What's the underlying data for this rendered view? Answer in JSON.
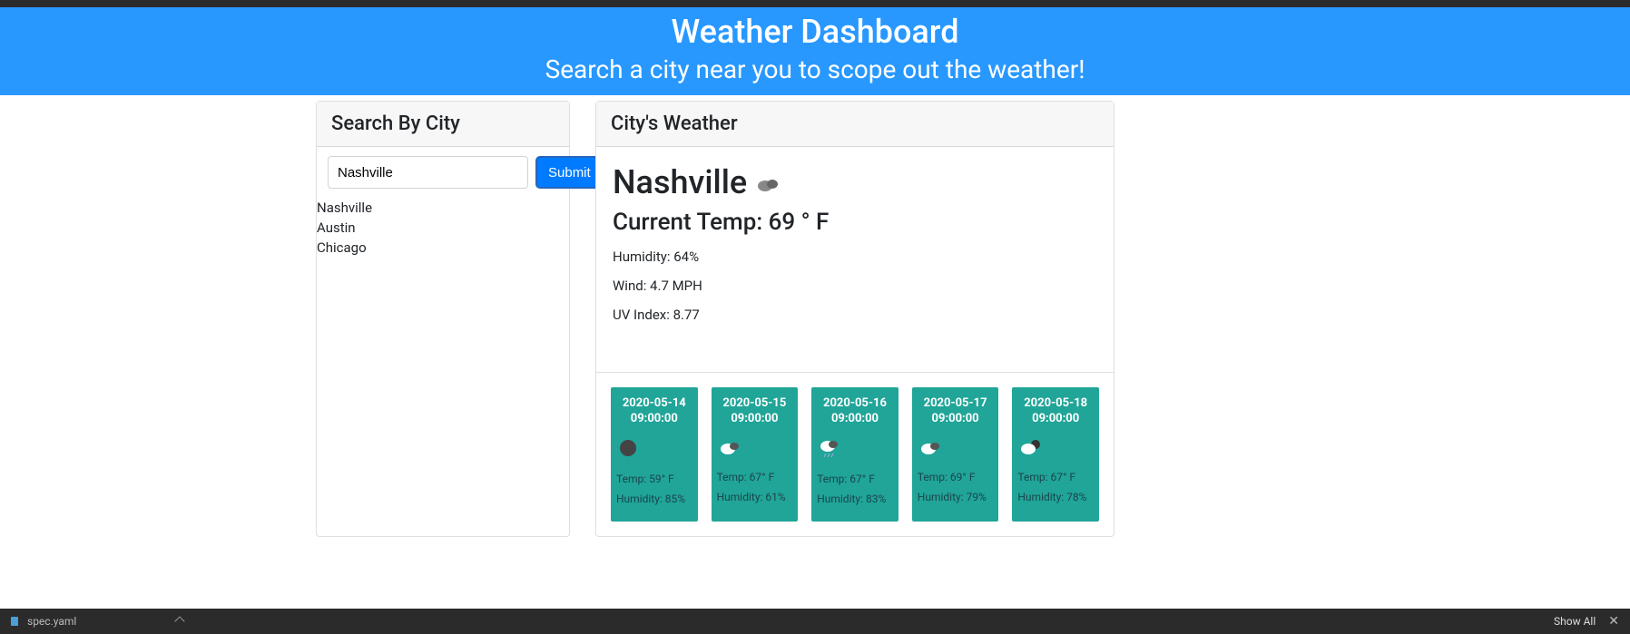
{
  "header": {
    "title": "Weather Dashboard",
    "subtitle": "Search a city near you to scope out the weather!"
  },
  "search": {
    "header": "Search By City",
    "input_value": "Nashville",
    "submit_label": "Submit",
    "history": [
      "Nashville",
      "Austin",
      "Chicago"
    ]
  },
  "weather": {
    "header": "City's Weather",
    "city": "Nashville",
    "current_temp_label": "Current Temp: 69 ° F",
    "humidity": "Humidity: 64%",
    "wind": "Wind: 4.7 MPH",
    "uv": "UV Index: 8.77"
  },
  "forecast": [
    {
      "date": "2020-05-14 09:00:00",
      "icon": "circle",
      "temp": "Temp: 59° F",
      "humidity": "Humidity: 85%"
    },
    {
      "date": "2020-05-15 09:00:00",
      "icon": "cloud",
      "temp": "Temp: 67° F",
      "humidity": "Humidity: 61%"
    },
    {
      "date": "2020-05-16 09:00:00",
      "icon": "cloud-rain",
      "temp": "Temp: 67° F",
      "humidity": "Humidity: 83%"
    },
    {
      "date": "2020-05-17 09:00:00",
      "icon": "cloud",
      "temp": "Temp: 69° F",
      "humidity": "Humidity: 79%"
    },
    {
      "date": "2020-05-18 09:00:00",
      "icon": "sun-cloud",
      "temp": "Temp: 67° F",
      "humidity": "Humidity: 78%"
    }
  ],
  "bottom": {
    "filename": "spec.yaml",
    "show_all": "Show All"
  }
}
